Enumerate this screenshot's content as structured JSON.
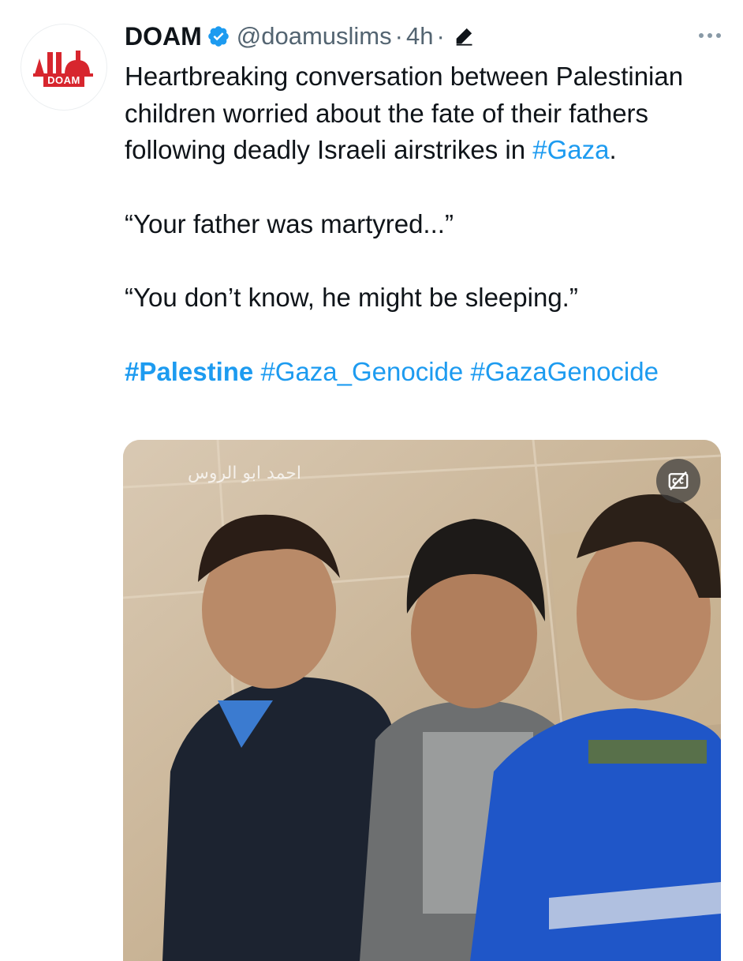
{
  "tweet": {
    "author": {
      "display_name": "DOAM",
      "handle": "@doamuslims",
      "verified": true,
      "avatar_logo_text": "DOAM"
    },
    "separator": "·",
    "time": "4h",
    "edited_icon": "pencil-icon",
    "more_icon": "more-horizontal-icon",
    "body": {
      "intro_before": "Heartbreaking conversation between Palestinian children worried about the fate of their fathers following deadly Israeli airstrikes in ",
      "intro_hashtag": "#Gaza",
      "intro_after": ".",
      "quote1": "“Your father was martyred...”",
      "quote2": "“You don’t know, he might be sleeping.”",
      "hashtags": [
        "#Palestine",
        "#Gaza_Genocide",
        "#GazaGenocide"
      ]
    },
    "media": {
      "watermark": "احمد ابو الروس",
      "caption_toggle_icon": "closed-captions-off-icon"
    }
  },
  "colors": {
    "link": "#1d9bf0",
    "text": "#0f1419",
    "secondary": "#536471",
    "brand_red": "#d7262e"
  }
}
